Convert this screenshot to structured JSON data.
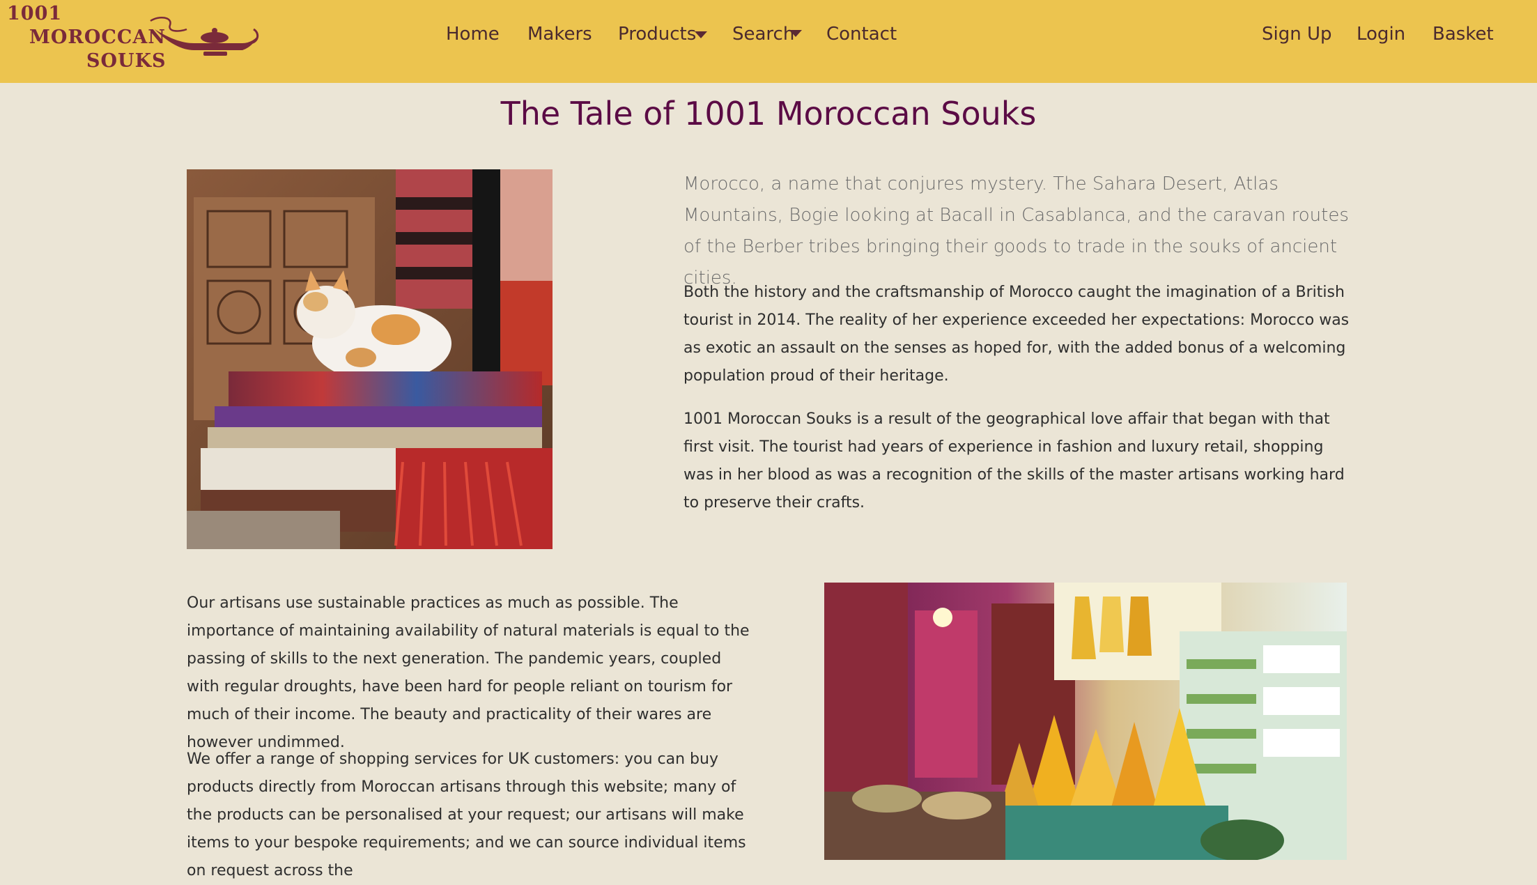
{
  "brand": {
    "logo_line1": "1001",
    "logo_line2": "MOROCCAN",
    "logo_line3": "SOUKS",
    "color": "#ecc44f",
    "logo_color": "#7a2a3a"
  },
  "nav": {
    "home": "Home",
    "makers": "Makers",
    "products": "Products",
    "search": "Search",
    "contact": "Contact",
    "signup": "Sign Up",
    "login": "Login",
    "basket": "Basket"
  },
  "page": {
    "title": "The Tale of 1001 Moroccan Souks",
    "title_color": "#5b0b45",
    "lead": "Morocco, a name that conjures mystery. The Sahara Desert, Atlas Mountains, Bogie looking at Bacall in Casablanca, and the caravan routes of the Berber tribes bringing their goods to trade in the souks of ancient cities.",
    "para1": "Both the history and the craftsmanship of Morocco caught the imagination of a British tourist in 2014. The reality of her experience exceeded her expectations: Morocco was as exotic an assault on the senses as hoped for, with the added bonus of a welcoming population proud of their heritage.",
    "para2": "1001 Moroccan Souks is a result of the geographical love affair that began with that first visit. The tourist had years of experience in fashion and luxury retail, shopping was in her blood as was a recognition of the skills of the master artisans working hard to preserve their crafts.",
    "para3": "Our artisans use sustainable practices as much as possible. The importance of maintaining availability of natural materials is equal to the passing of skills to the next generation. The pandemic years, coupled with regular droughts, have been hard for people reliant on tourism for much of their income. The beauty and practicality of their wares are however undimmed.",
    "para4": "We offer a range of shopping services for UK customers: you can buy products directly from Moroccan artisans through this website; many of the products can be personalised at your request; our artisans will make items to your bespoke requirements; and we can source individual items on request across the"
  },
  "background_color": "#ebe5d6"
}
